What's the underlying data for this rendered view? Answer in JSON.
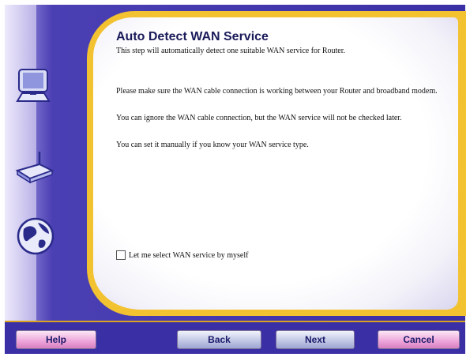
{
  "wizard": {
    "title": "Auto Detect WAN Service",
    "subtitle": "This step will automatically detect one suitable WAN service for Router.",
    "paragraphs": [
      "Please make sure the WAN cable connection is working between your Router and broadband modem.",
      "You can ignore the WAN cable connection, but the WAN service will not be checked later.",
      "You can set it manually if you know your WAN service type."
    ],
    "checkbox_label": "Let me select WAN service by myself",
    "checkbox_checked": false
  },
  "sidebar_icons": [
    "computer-icon",
    "router-icon",
    "globe-icon"
  ],
  "buttons": {
    "help": "Help",
    "back": "Back",
    "next": "Next",
    "cancel": "Cancel"
  },
  "colors": {
    "background_purple": "#3a2fa5",
    "accent_gold": "#f2c230",
    "help_cancel_pink": "#efa9dc",
    "back_next_blue": "#c2c8e6"
  }
}
